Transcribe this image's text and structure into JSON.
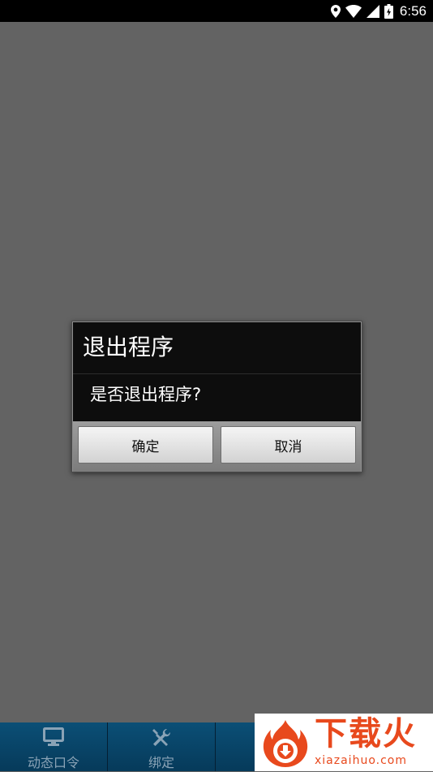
{
  "status_bar": {
    "time": "6:56",
    "icons": [
      "location-icon",
      "wifi-icon",
      "signal-icon",
      "battery-icon"
    ]
  },
  "dialog": {
    "title": "退出程序",
    "message": "是否退出程序?",
    "ok_label": "确定",
    "cancel_label": "取消"
  },
  "tabs": [
    {
      "label": "动态口令",
      "icon": "monitor-icon"
    },
    {
      "label": "绑定",
      "icon": "tools-icon"
    },
    {
      "label": "",
      "icon": ""
    },
    {
      "label": "",
      "icon": ""
    }
  ],
  "watermark": {
    "brand": "下载火",
    "url": "xiazaihuo.com"
  },
  "colors": {
    "background": "#636363",
    "tab_bar": "#063a5a",
    "dialog_bg": "#0d0d0d",
    "watermark": "#e8491d"
  }
}
